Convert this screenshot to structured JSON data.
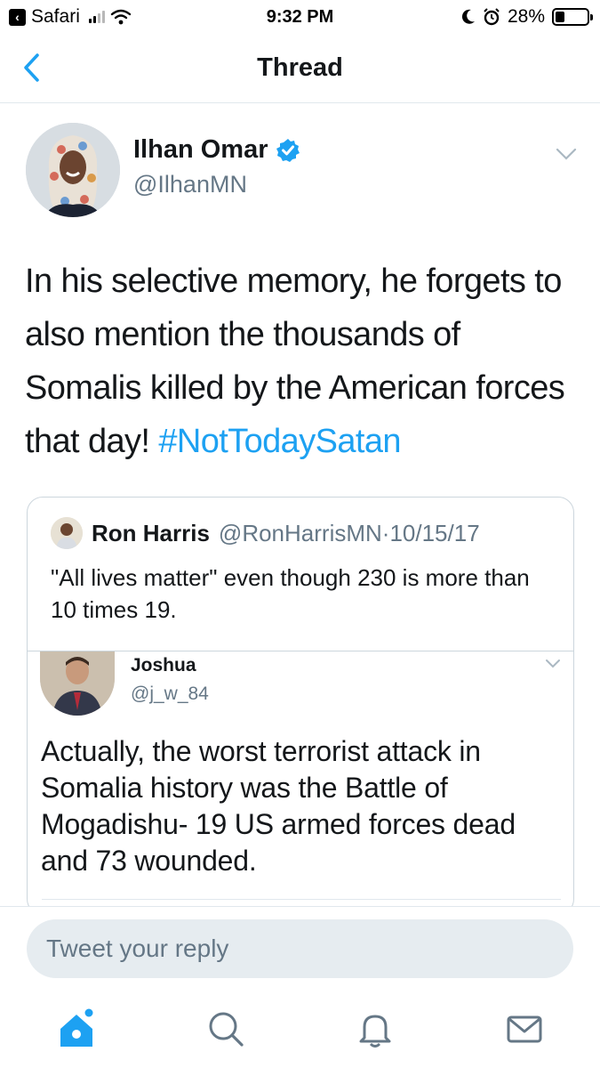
{
  "status_bar": {
    "app_back": "Safari",
    "time": "9:32 PM",
    "battery": "28%",
    "battery_level": 0.28
  },
  "nav": {
    "title": "Thread"
  },
  "tweet": {
    "name": "Ilhan Omar",
    "handle": "@IlhanMN",
    "verified": true,
    "text": "In his selective memory, he forgets to also mention the thousands of Somalis killed by the American forces that day!",
    "hashtag": "#NotTodaySatan"
  },
  "quoted": {
    "name": "Ron Harris",
    "handle": "@RonHarrisMN",
    "separator": "·",
    "date": "10/15/17",
    "text": "\"All lives matter\" even though 230 is more than 10 times 19.",
    "inner": {
      "name": "Joshua",
      "handle": "@j_w_84",
      "text": "Actually, the worst terrorist attack in Somalia history was the Battle of Mogadishu- 19 US armed forces dead and 73 wounded."
    }
  },
  "reply": {
    "placeholder": "Tweet your reply"
  },
  "colors": {
    "accent": "#1da1f2",
    "muted": "#657786",
    "border": "#ccd6dd",
    "input_bg": "#e6ecf0"
  },
  "tabs": [
    {
      "icon": "home-icon",
      "active": true
    },
    {
      "icon": "search-icon",
      "active": false
    },
    {
      "icon": "bell-icon",
      "active": false
    },
    {
      "icon": "mail-icon",
      "active": false
    }
  ]
}
